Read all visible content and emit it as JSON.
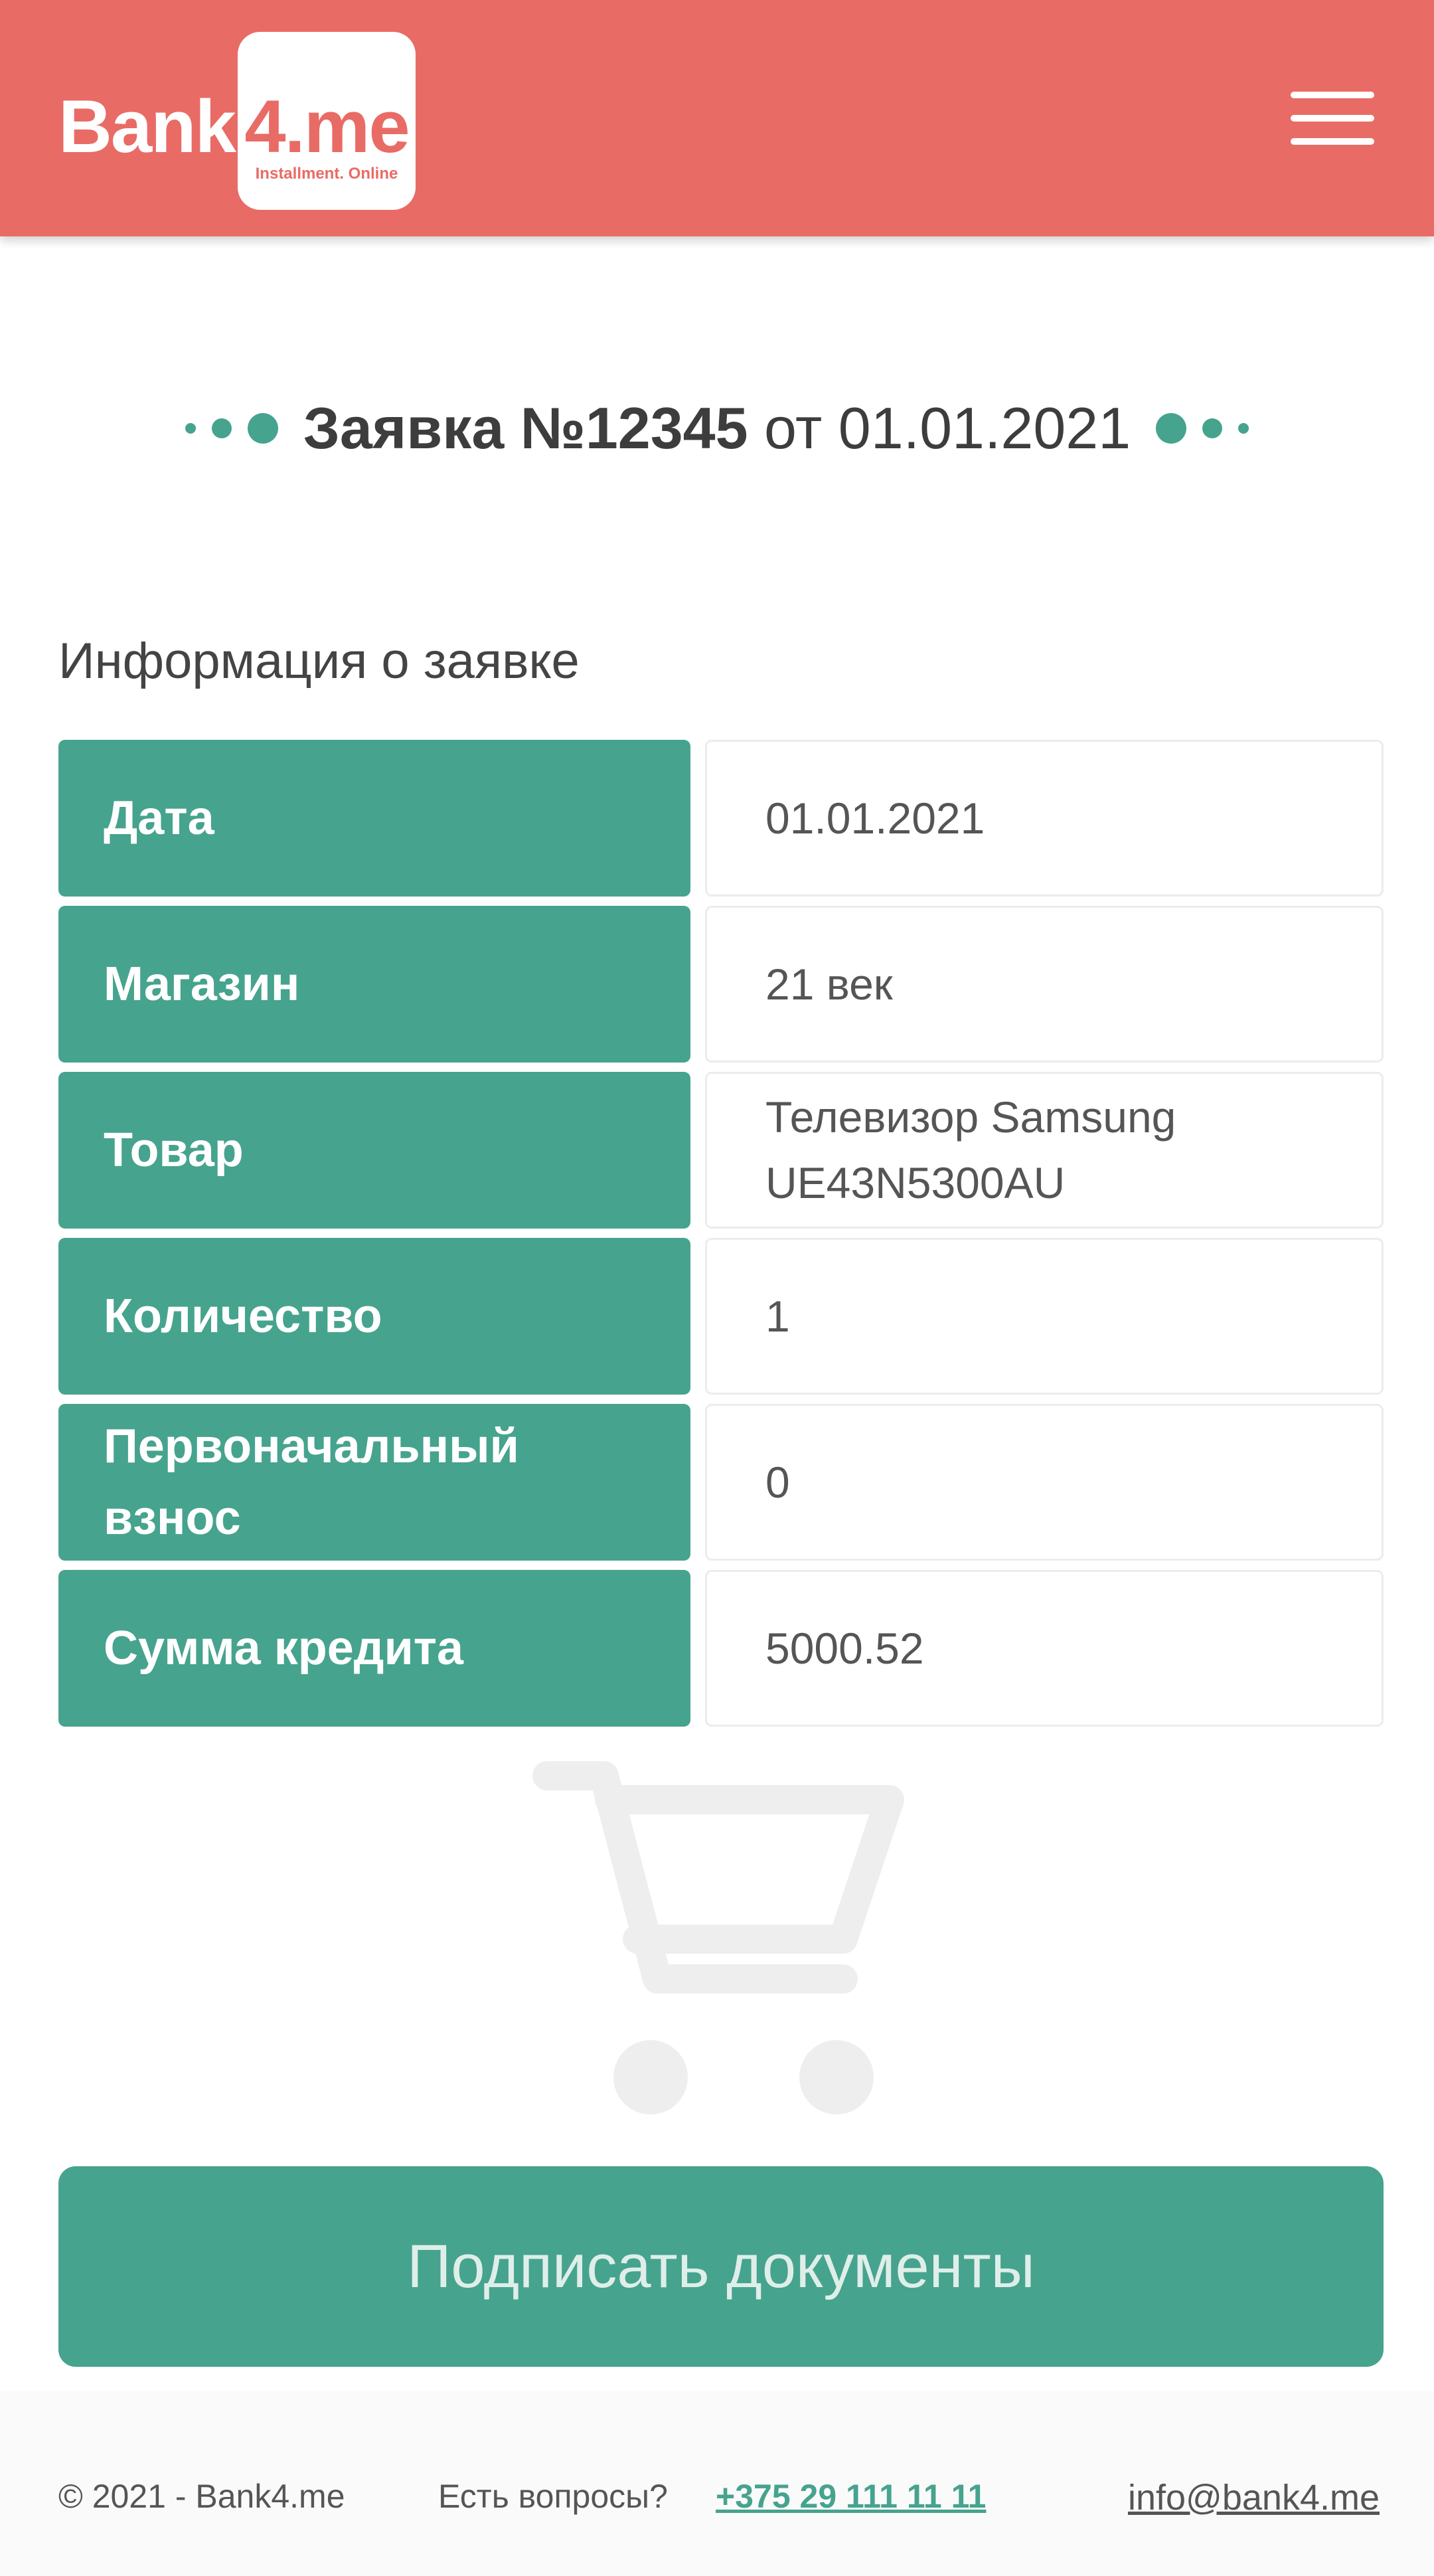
{
  "header": {
    "logo_text_main": "Bank",
    "logo_text_badge": "4.me",
    "logo_tagline": "Installment. Online",
    "background_color": "#e96b66"
  },
  "application": {
    "title_prefix": "Заявка №12345",
    "title_suffix": "от 01.01.2021"
  },
  "info": {
    "section_title": "Информация о заявке",
    "rows": [
      {
        "label": "Дата",
        "value": "01.01.2021"
      },
      {
        "label": "Магазин",
        "value": "21 век"
      },
      {
        "label": "Товар",
        "value": "Телевизор Samsung UE43N5300AU"
      },
      {
        "label": "Количество",
        "value": "1"
      },
      {
        "label": "Первоначальный взнос",
        "value": "0"
      },
      {
        "label": "Сумма кредита",
        "value": "5000.52"
      }
    ]
  },
  "actions": {
    "sign_documents_label": "Подписать документы"
  },
  "footer": {
    "copyright": "© 2021 - Bank4.me",
    "questions_label": "Есть вопросы?",
    "phone": "+375 29 111 11 11",
    "email": "info@bank4.me"
  },
  "icons": {
    "menu": "hamburger-icon",
    "cart": "shopping-cart-icon"
  },
  "colors": {
    "accent": "#46a38e",
    "brand": "#e96b66"
  }
}
